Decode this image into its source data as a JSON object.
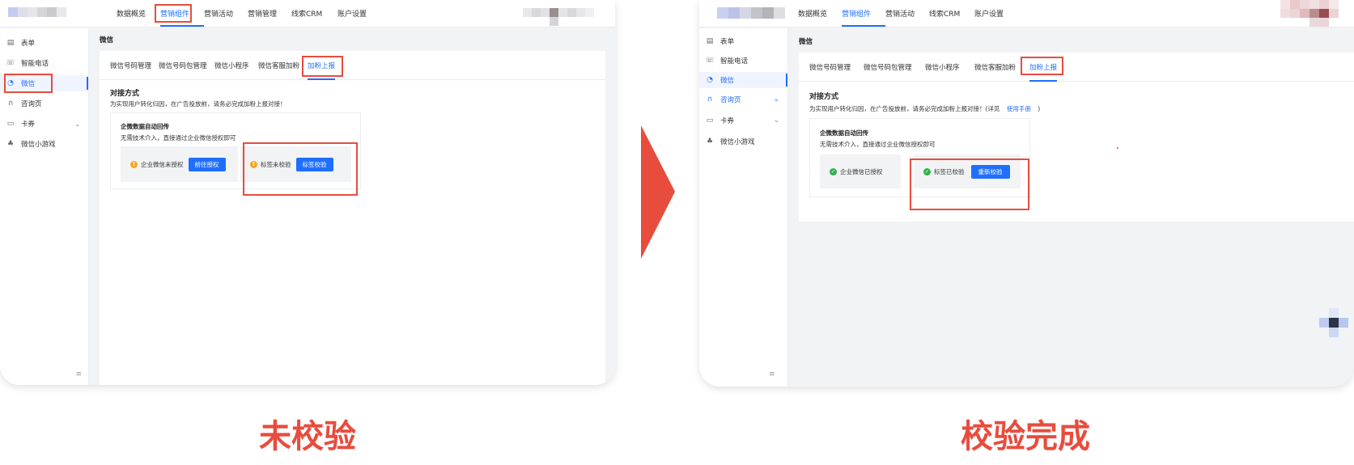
{
  "colors": {
    "accent": "#1f6fff",
    "annotation_red": "#e84c3d",
    "warning": "#f5a623",
    "success": "#2fb34a"
  },
  "left": {
    "nav": [
      "数据概览",
      "营销组件",
      "营销活动",
      "营销管理",
      "线索CRM",
      "账户设置"
    ],
    "sidebar": [
      {
        "icon": "form-icon",
        "glyph": "▤",
        "label": "表单"
      },
      {
        "icon": "phone-icon",
        "glyph": "☏",
        "label": "智能电话"
      },
      {
        "icon": "wechat-icon",
        "glyph": "◔",
        "label": "微信"
      },
      {
        "icon": "headset-icon",
        "glyph": "∩",
        "label": "咨询页"
      },
      {
        "icon": "card-icon",
        "glyph": "▭",
        "label": "卡券"
      },
      {
        "icon": "game-icon",
        "glyph": "♣",
        "label": "微信小游戏"
      }
    ],
    "collapse_glyph": "≡",
    "page_title": "微信",
    "tabs": [
      "微信号码管理",
      "微信号码包管理",
      "微信小程序",
      "微信客服加粉",
      "加粉上报"
    ],
    "section_title": "对接方式",
    "section_desc": "为实现用户转化归因，在广告投放前，请务必完成加粉上报对接！",
    "card_title": "企微数据自动回传",
    "card_desc": "无需技术介入，直接通过企业微信授权即可",
    "status1": {
      "icon": "warning-icon",
      "glyph": "!",
      "text": "企业微信未授权",
      "button": "前往授权"
    },
    "status2": {
      "icon": "warning-icon",
      "glyph": "!",
      "text": "标签未校验",
      "button": "标签校验"
    },
    "caption": "未校验"
  },
  "right": {
    "nav": [
      "数据概览",
      "营销组件",
      "营销活动",
      "线索CRM",
      "账户设置"
    ],
    "sidebar": [
      {
        "icon": "form-icon",
        "glyph": "▤",
        "label": "表单"
      },
      {
        "icon": "phone-icon",
        "glyph": "☏",
        "label": "智能电话"
      },
      {
        "icon": "wechat-icon",
        "glyph": "◔",
        "label": "微信"
      },
      {
        "icon": "headset-icon",
        "glyph": "∩",
        "label": "咨询页"
      },
      {
        "icon": "card-icon",
        "glyph": "▭",
        "label": "卡券"
      },
      {
        "icon": "game-icon",
        "glyph": "♣",
        "label": "微信小游戏"
      }
    ],
    "collapse_glyph": "≡",
    "chevron": "⌄",
    "page_title": "微信",
    "tabs": [
      "微信号码管理",
      "微信号码包管理",
      "微信小程序",
      "微信客服加粉",
      "加粉上报"
    ],
    "section_title": "对接方式",
    "section_desc_before": "为实现用户转化归因，在广告投放前，请务必完成加粉上报对接！(详见",
    "section_desc_link": "使用手册",
    "section_desc_after": ")",
    "card_title": "企微数据自动回传",
    "card_desc": "无需技术介入，直接通过企业微信授权即可",
    "status1": {
      "icon": "check-circle-icon",
      "glyph": "✓",
      "text": "企业微信已授权"
    },
    "status2": {
      "icon": "check-circle-icon",
      "glyph": "✓",
      "text": "标签已校验",
      "button": "重新校验"
    },
    "caption": "校验完成"
  }
}
